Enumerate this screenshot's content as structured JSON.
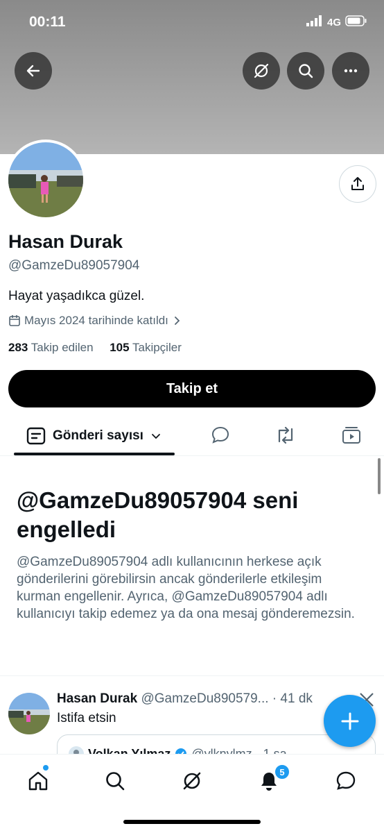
{
  "status_bar": {
    "time": "00:11",
    "network": "4G"
  },
  "header": {
    "back_icon": "arrow-left-icon",
    "grok_icon": "grok-icon",
    "search_icon": "search-icon",
    "more_icon": "more-horizontal-icon"
  },
  "profile": {
    "name": "Hasan Durak",
    "handle": "@GamzeDu89057904",
    "bio": "Hayat yaşadıkca güzel.",
    "joined": "Mayıs 2024 tarihinde katıldı",
    "following_count": "283",
    "following_label": "Takip edilen",
    "followers_count": "105",
    "followers_label": "Takipçiler",
    "follow_button": "Takip et"
  },
  "tabs": {
    "posts_label": "Gönderi sayısı",
    "icons": [
      "reply-icon",
      "retweet-icon",
      "media-icon"
    ]
  },
  "blocked": {
    "title": "@GamzeDu89057904 seni engelledi",
    "description": "@GamzeDu89057904 adlı kullanıcının herkese açık gönderilerini görebilirsin ancak gönderilerle etkileşim kurman engellenir. Ayrıca, @GamzeDu89057904 adlı kullanıcıyı takip edemez ya da ona mesaj gönderemezsin."
  },
  "tweet": {
    "author": "Hasan Durak",
    "handle": "@GamzeDu890579...",
    "time": "· 41 dk",
    "text": "Istifa etsin",
    "quote_author": "Volkan Yılmaz",
    "quote_handle": "@ylknylmz · 1 sa"
  },
  "bottom_nav": {
    "items": [
      "home-icon",
      "search-icon",
      "grok-icon",
      "notifications-icon",
      "messages-icon"
    ],
    "notifications_badge": "5"
  },
  "colors": {
    "accent": "#1d9bf0",
    "text": "#0f1419",
    "secondary": "#536471"
  }
}
